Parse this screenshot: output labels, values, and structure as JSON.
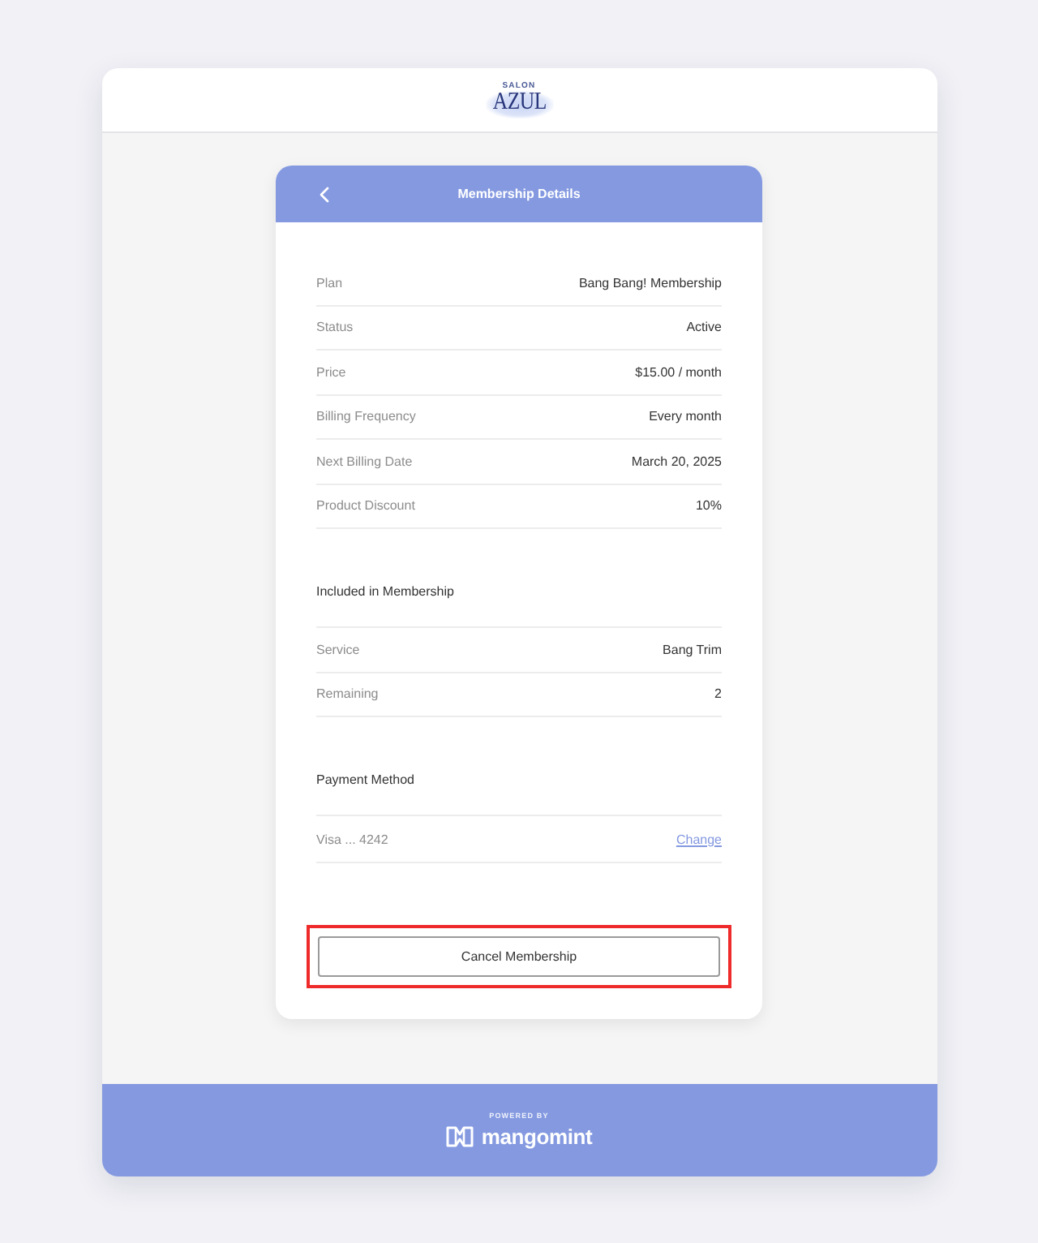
{
  "header": {
    "logo_small": "SALON",
    "logo": "AZUL"
  },
  "card": {
    "title": "Membership Details",
    "details": [
      {
        "label": "Plan",
        "value": "Bang Bang! Membership"
      },
      {
        "label": "Status",
        "value": "Active"
      },
      {
        "label": "Price",
        "value": "$15.00 / month"
      },
      {
        "label": "Billing Frequency",
        "value": "Every month"
      },
      {
        "label": "Next Billing Date",
        "value": "March 20, 2025"
      },
      {
        "label": "Product Discount",
        "value": "10%"
      }
    ],
    "included": {
      "heading": "Included in Membership",
      "rows": [
        {
          "label": "Service",
          "value": "Bang Trim"
        },
        {
          "label": "Remaining",
          "value": "2"
        }
      ]
    },
    "payment": {
      "heading": "Payment Method",
      "card": "Visa ... 4242",
      "action": "Change"
    },
    "cancel_button": {
      "label": "Cancel Membership",
      "highlighted": true
    }
  },
  "footer": {
    "powered_by": "POWERED BY",
    "brand": "mangomint"
  }
}
